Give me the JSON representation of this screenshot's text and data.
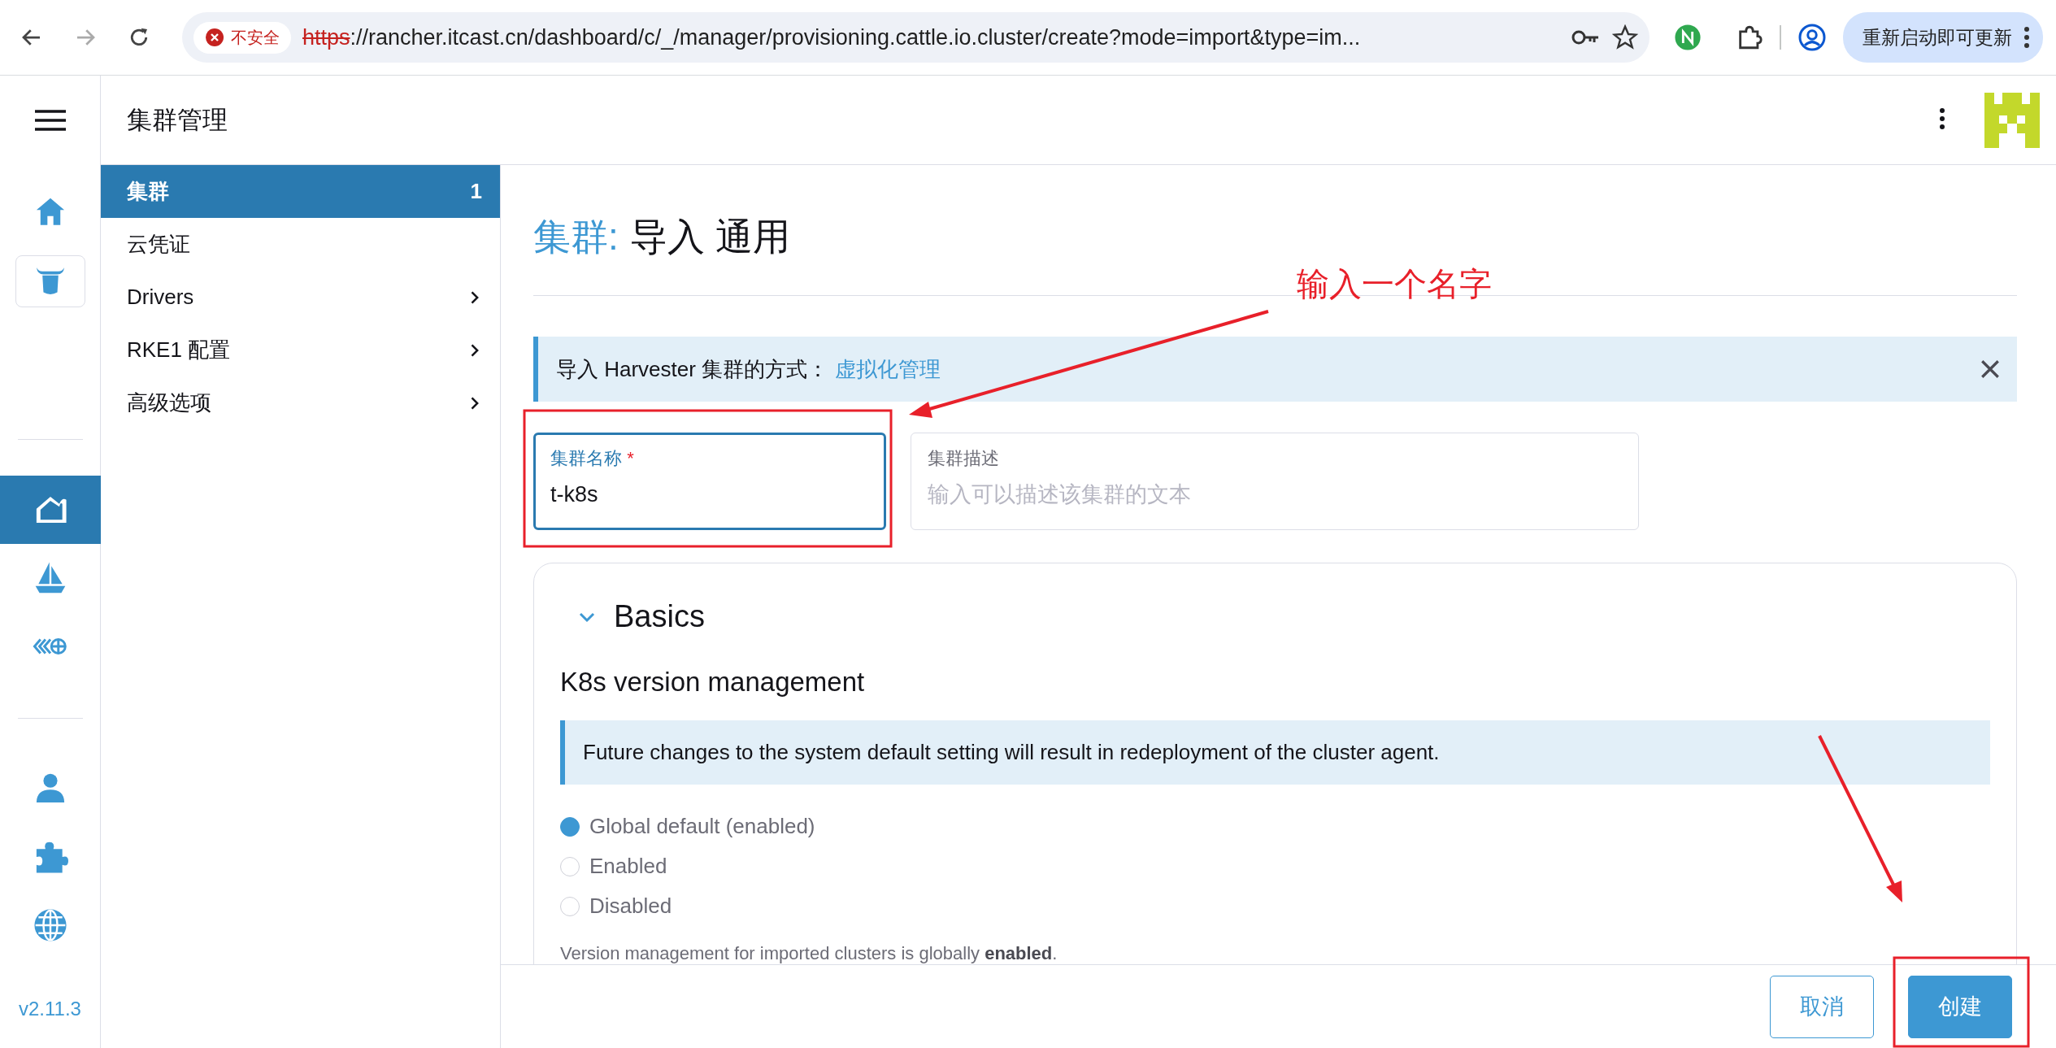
{
  "browser": {
    "security_label": "不安全",
    "url_scheme": "https",
    "url_rest": "://rancher.itcast.cn/dashboard/c/_/manager/provisioning.cattle.io.cluster/create?mode=import&type=im...",
    "update_button": "重新启动即可更新"
  },
  "header": {
    "title": "集群管理"
  },
  "rail": {
    "items": [
      {
        "selected": false
      },
      {
        "selected": false
      },
      {
        "selected": true
      },
      {
        "selected": false
      },
      {
        "selected": false
      },
      {
        "selected": false
      },
      {
        "selected": false
      },
      {
        "selected": false
      }
    ],
    "version": "v2.11.3"
  },
  "nav": {
    "items": [
      {
        "label": "集群",
        "count": "1",
        "selected": true,
        "has_children": false
      },
      {
        "label": "云凭证",
        "selected": false,
        "has_children": false
      },
      {
        "label": "Drivers",
        "selected": false,
        "has_children": true
      },
      {
        "label": "RKE1 配置",
        "selected": false,
        "has_children": true
      },
      {
        "label": "高级选项",
        "selected": false,
        "has_children": true
      }
    ]
  },
  "page": {
    "title_prefix": "集群:",
    "title": "导入 通用"
  },
  "banner": {
    "text": "导入 Harvester 集群的方式：",
    "link": "虚拟化管理"
  },
  "fields": [
    {
      "label": "集群名称",
      "required_mark": "*",
      "value": "t-k8s",
      "focused": true
    },
    {
      "label": "集群描述",
      "placeholder": "输入可以描述该集群的文本",
      "focused": false
    }
  ],
  "card": {
    "section": "Basics",
    "expanded": true,
    "heading": "K8s version management",
    "info": "Future changes to the system default setting will result in redeployment of the cluster agent.",
    "radios": [
      {
        "label": "Global default (enabled)",
        "selected": true
      },
      {
        "label": "Enabled",
        "selected": false
      },
      {
        "label": "Disabled",
        "selected": false
      }
    ],
    "note": "Version management for imported clusters is globally **enabled**."
  },
  "footer": {
    "buttons": [
      {
        "label": "取消",
        "kind": "secondary"
      },
      {
        "label": "创建",
        "kind": "primary"
      }
    ]
  },
  "annotation": {
    "text": "输入一个名字"
  }
}
